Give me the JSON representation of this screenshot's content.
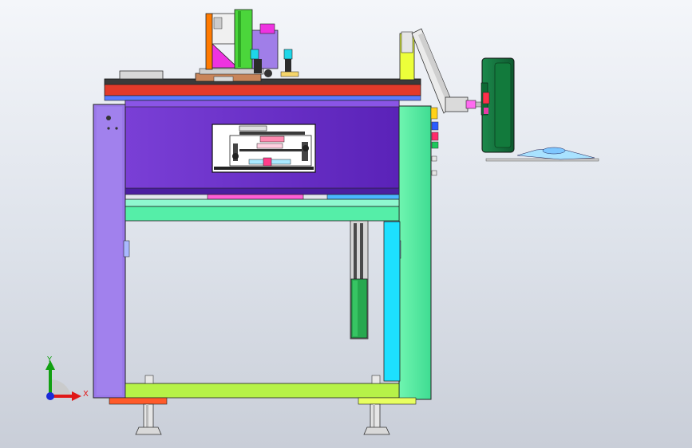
{
  "view": {
    "background_top": "#f4f6fa",
    "background_bottom": "#c9ced8"
  },
  "triad": {
    "x_label": "X",
    "y_label": "Y",
    "x_color": "#e01818",
    "y_color": "#12a012",
    "z_color": "#1a2ad8"
  },
  "parts": [
    "machine-frame",
    "left-column",
    "right-column",
    "top-plate",
    "upper-housing",
    "inspection-window",
    "crossbeam",
    "base-beam",
    "leveling-feet",
    "press-module",
    "linear-actuator",
    "control-panel",
    "swing-arm",
    "keyboard-tray"
  ]
}
